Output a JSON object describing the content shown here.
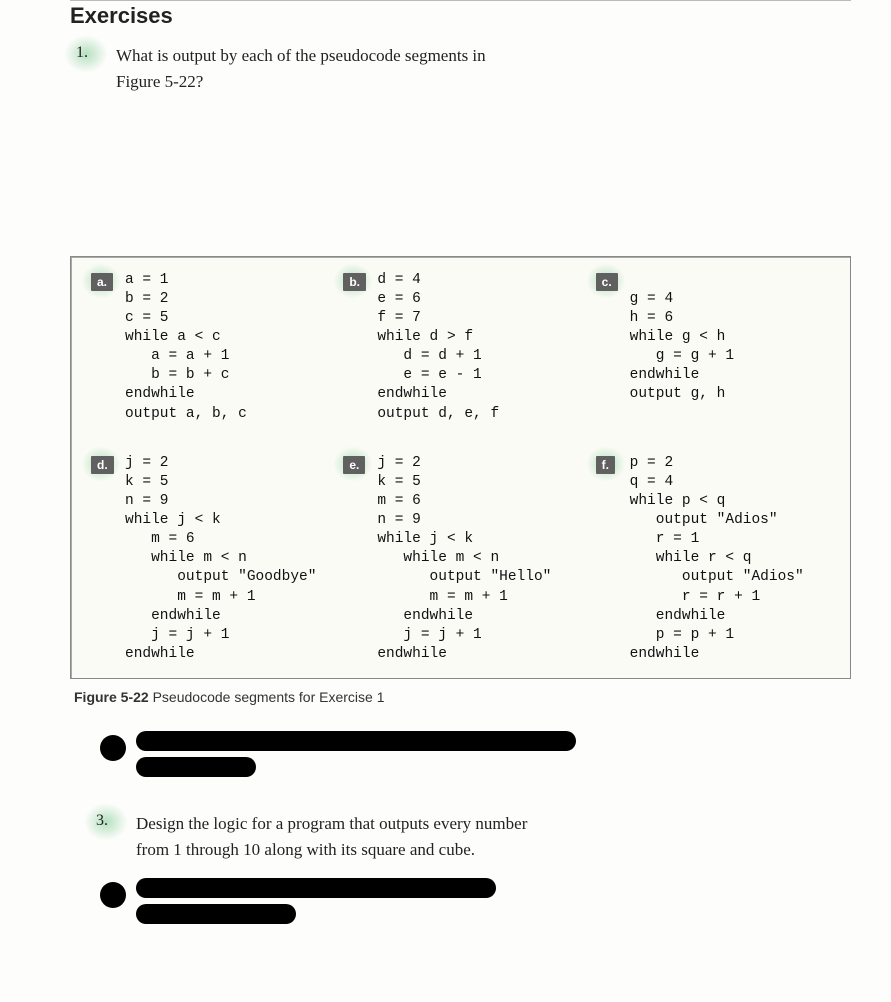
{
  "section_title": "Exercises",
  "q1": {
    "number": "1.",
    "text_line1": "What is output by each of the pseudocode segments in",
    "text_line2": "Figure 5-22?"
  },
  "labels": {
    "a": "a.",
    "b": "b.",
    "c": "c.",
    "d": "d.",
    "e": "e.",
    "f": "f."
  },
  "code": {
    "a": "a = 1\nb = 2\nc = 5\nwhile a < c\n   a = a + 1\n   b = b + c\nendwhile\noutput a, b, c",
    "b": "d = 4\ne = 6\nf = 7\nwhile d > f\n   d = d + 1\n   e = e - 1\nendwhile\noutput d, e, f",
    "c": "\ng = 4\nh = 6\nwhile g < h\n   g = g + 1\nendwhile\noutput g, h",
    "d": "j = 2\nk = 5\nn = 9\nwhile j < k\n   m = 6\n   while m < n\n      output \"Goodbye\"\n      m = m + 1\n   endwhile\n   j = j + 1\nendwhile",
    "e": "j = 2\nk = 5\nm = 6\nn = 9\nwhile j < k\n   while m < n\n      output \"Hello\"\n      m = m + 1\n   endwhile\n   j = j + 1\nendwhile",
    "f": "p = 2\nq = 4\nwhile p < q\n   output \"Adios\"\n   r = 1\n   while r < q\n      output \"Adios\"\n      r = r + 1\n   endwhile\n   p = p + 1\nendwhile"
  },
  "caption": {
    "bold": "Figure 5-22",
    "rest": "   Pseudocode segments for Exercise 1"
  },
  "q3": {
    "number": "3.",
    "text_line1": "Design the logic for a program that outputs every number",
    "text_line2": "from 1 through 10 along with its square and cube."
  }
}
